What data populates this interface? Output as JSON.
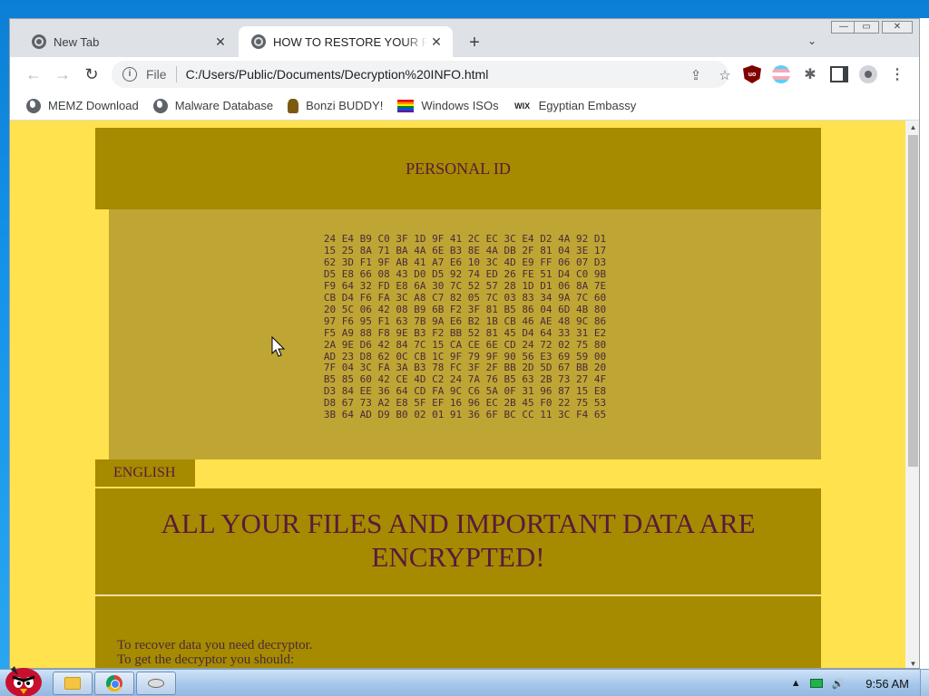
{
  "browser": {
    "tabs": [
      {
        "title": "New Tab",
        "active": false
      },
      {
        "title": "HOW TO RESTORE YOUR FILES",
        "active": true
      }
    ],
    "new_tab_symbol": "+",
    "tab_search_symbol": "⌄",
    "window_controls": {
      "minimize": "—",
      "maximize": "▭",
      "close": "✕"
    },
    "toolbar": {
      "back": "←",
      "forward": "→",
      "reload": "↻",
      "scheme": "File",
      "url": "C:/Users/Public/Documents/Decryption%20INFO.html",
      "share": "⇪",
      "star": "☆",
      "puzzle": "✱",
      "menu": "⋮",
      "ublock": "uo"
    },
    "bookmarks": [
      {
        "label": "MEMZ Download",
        "icon": "globe-icon"
      },
      {
        "label": "Malware Database",
        "icon": "globe-icon"
      },
      {
        "label": "Bonzi BUDDY!",
        "icon": "bonzi-icon"
      },
      {
        "label": "Windows ISOs",
        "icon": "rainbow-flag-icon"
      },
      {
        "label": "Egyptian Embassy",
        "icon": "wix-icon",
        "icon_text": "WIX"
      }
    ]
  },
  "page": {
    "personal_id_title": "PERSONAL ID",
    "personal_id_hex": "24 E4 B9 C0 3F 1D 9F 41 2C EC 3C E4 D2 4A 92 D1\n15 25 8A 71 BA 4A 6E B3 8E 4A DB 2F 81 04 3E 17\n62 3D F1 9F AB 41 A7 E6 10 3C 4D E9 FF 06 07 D3\nD5 E8 66 08 43 D0 D5 92 74 ED 26 FE 51 D4 C0 9B\nF9 64 32 FD E8 6A 30 7C 52 57 28 1D D1 06 8A 7E\nCB D4 F6 FA 3C A8 C7 82 05 7C 03 83 34 9A 7C 60\n20 5C 06 42 08 B9 6B F2 3F 81 B5 86 04 6D 4B 80\n97 F6 95 F1 63 7B 9A E6 B2 1B CB 46 AE 48 9C 86\nF5 A9 88 F8 9E B3 F2 BB 52 81 45 D4 64 33 31 E2\n2A 9E D6 42 84 7C 15 CA CE 6E CD 24 72 02 75 80\nAD 23 D8 62 0C CB 1C 9F 79 9F 90 56 E3 69 59 00\n7F 04 3C FA 3A B3 78 FC 3F 2F BB 2D 5D 67 BB 20\nB5 85 60 42 CE 4D C2 24 7A 76 B5 63 2B 73 27 4F\nD3 84 EE 36 64 CD FA 9C C6 5A 0F 31 96 87 15 E8\nD8 67 73 A2 E8 5F EF 16 96 EC 2B 45 F0 22 75 53\n3B 64 AD D9 B0 02 01 91 36 6F BC CC 11 3C F4 65",
    "language_tab": "ENGLISH",
    "headline": "ALL YOUR FILES AND IMPORTANT DATA ARE ENCRYPTED!",
    "body_line1": "To recover data you need decryptor.",
    "body_line2": "To get the decryptor you should:"
  },
  "taskbar": {
    "clock": "9:56 AM",
    "tray_up": "▲",
    "tray_volume": "🔊"
  },
  "colors": {
    "page_bg": "#ffe24d",
    "panel": "#a68a00",
    "id_box": "#bfa534",
    "text": "#5a1a3c"
  }
}
